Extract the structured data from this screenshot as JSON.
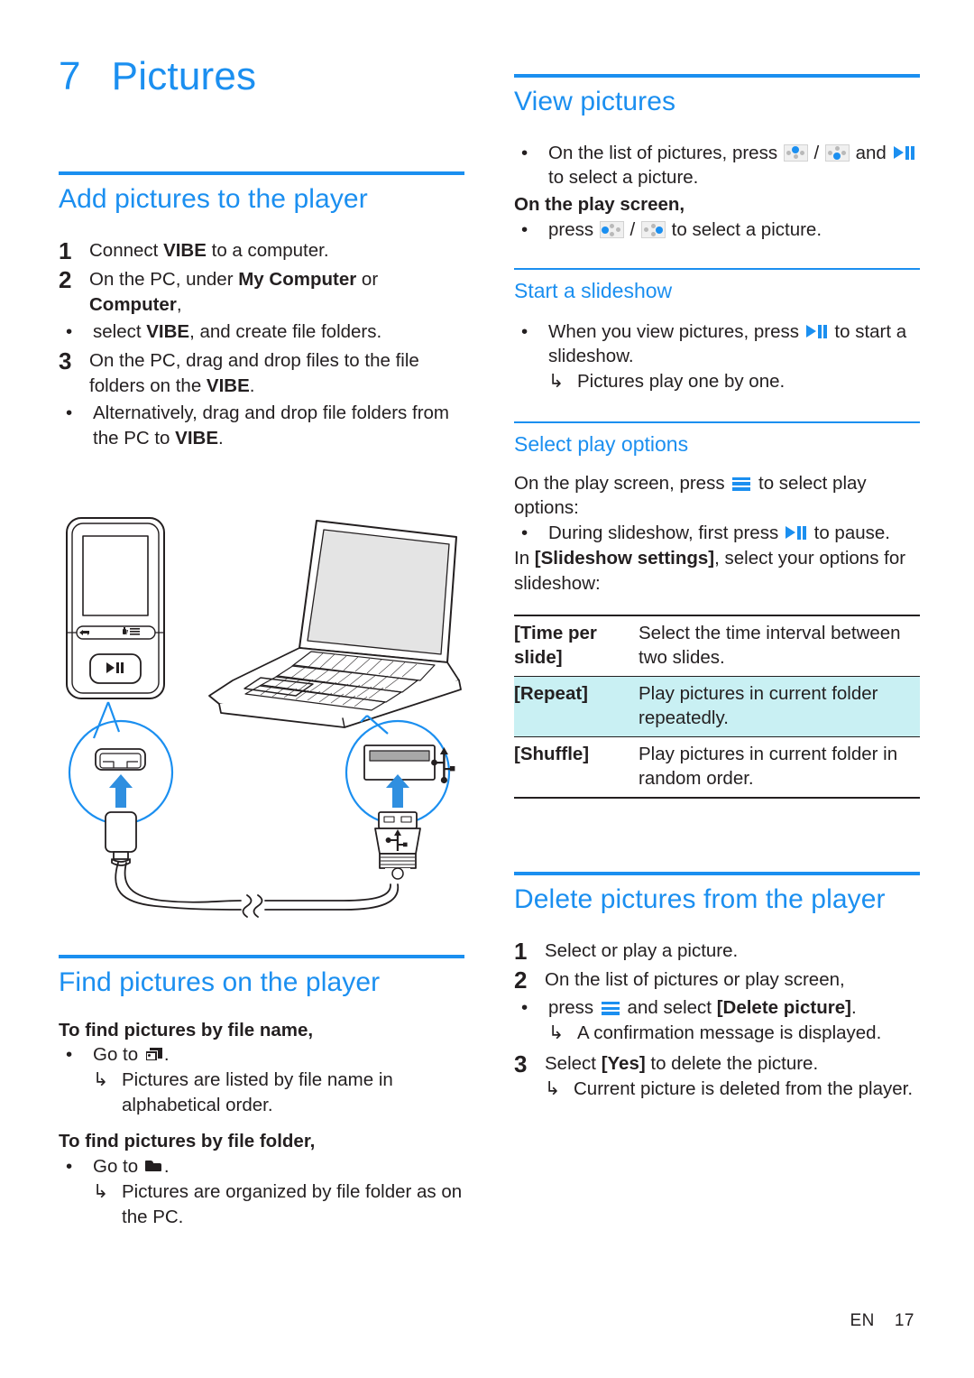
{
  "meta": {
    "accent_color": "#1b8ff0",
    "text_color": "#231f20",
    "highlight_row_color": "#c9f0f3"
  },
  "chapter": {
    "number": "7",
    "title": "Pictures"
  },
  "left_column": {
    "add_pictures": {
      "heading": "Add pictures to the player",
      "steps": [
        {
          "num": "1",
          "text_parts": [
            {
              "t": "Connect ",
              "b": false
            },
            {
              "t": "VIBE",
              "b": true
            },
            {
              "t": " to a computer.",
              "b": false
            }
          ],
          "plain": "Connect VIBE to a computer."
        },
        {
          "num": "2",
          "text_parts": [
            {
              "t": "On the PC, under ",
              "b": false
            },
            {
              "t": "My Computer",
              "b": true
            },
            {
              "t": " or ",
              "b": false
            },
            {
              "t": "Computer",
              "b": true
            },
            {
              "t": ",",
              "b": false
            }
          ],
          "plain": "On the PC, under My Computer or Computer,",
          "bullets": [
            {
              "text_parts": [
                {
                  "t": "select ",
                  "b": false
                },
                {
                  "t": "VIBE",
                  "b": true
                },
                {
                  "t": ", and create file folders.",
                  "b": false
                }
              ],
              "plain": "select VIBE, and create file folders."
            }
          ]
        },
        {
          "num": "3",
          "text_parts": [
            {
              "t": "On the PC, drag and drop files to the file folders on the ",
              "b": false
            },
            {
              "t": "VIBE",
              "b": true
            },
            {
              "t": ".",
              "b": false
            }
          ],
          "plain": "On the PC, drag and drop files to the file folders on the VIBE.",
          "bullets": [
            {
              "text_parts": [
                {
                  "t": "Alternatively, drag and drop file folders from the PC to ",
                  "b": false
                },
                {
                  "t": "VIBE",
                  "b": true
                },
                {
                  "t": ".",
                  "b": false
                }
              ],
              "plain": "Alternatively, drag and drop file folders from the PC to VIBE."
            }
          ]
        }
      ]
    },
    "illustration": {
      "name": "player-to-pc-usb-connection-diagram",
      "elements": [
        "mp3-player",
        "laptop",
        "usb-cable",
        "player-port-callout",
        "laptop-usb-port-callout",
        "usb-symbol"
      ]
    },
    "find_pictures": {
      "heading": "Find pictures on the player",
      "group_by_name": {
        "lead": "To find pictures by file name,",
        "bullet_prefix": "Go to",
        "bullet_icon": "pictures-icon",
        "bullet_suffix": ".",
        "result": "Pictures are listed by file name in alphabetical order."
      },
      "group_by_folder": {
        "lead": "To find pictures by file folder,",
        "bullet_prefix": "Go to",
        "bullet_icon": "folder-icon",
        "bullet_suffix": ".",
        "result": "Pictures are organized by file folder as on the PC."
      }
    }
  },
  "right_column": {
    "view_pictures": {
      "heading": "View pictures",
      "bullet1_pre": "On the list of pictures, press",
      "bullet1_mid": "/",
      "bullet1_post": "and",
      "bullet1_end": "to select a picture.",
      "lead_bold": "On the play screen,",
      "bullet2_pre": "press",
      "bullet2_mid": "/",
      "bullet2_post": "to select a picture."
    },
    "start_slideshow": {
      "heading": "Start a slideshow",
      "bullet_pre": "When you view pictures, press",
      "bullet_post": "to start a slideshow.",
      "result": "Pictures play one by one."
    },
    "select_play_options": {
      "heading": "Select play options",
      "lead_pre": "On the play screen, press",
      "lead_post": "to select play options:",
      "bullet_pre": "During slideshow, first press",
      "bullet_post": "to pause.",
      "in_text_pre": "In ",
      "in_text_bold": "[Slideshow settings]",
      "in_text_post": ", select your options for slideshow:",
      "table": {
        "rows": [
          {
            "key": "[Time per slide]",
            "value": "Select the time interval between two slides.",
            "highlight": false
          },
          {
            "key": "[Repeat]",
            "value": "Play pictures in current folder repeatedly.",
            "highlight": true
          },
          {
            "key": "[Shuffle]",
            "value": "Play pictures in current folder in random order.",
            "highlight": false
          }
        ]
      }
    },
    "delete_pictures": {
      "heading": "Delete pictures from the player",
      "steps": [
        {
          "num": "1",
          "plain": "Select or play a picture."
        },
        {
          "num": "2",
          "plain": "On the list of pictures or play screen,"
        }
      ],
      "step2_bullet_pre": "press",
      "step2_bullet_mid": "and select",
      "step2_bullet_bold": "[Delete picture]",
      "step2_bullet_end": ".",
      "step2_result": "A confirmation message is displayed.",
      "step3_num": "3",
      "step3_pre": "Select",
      "step3_bold": "[Yes]",
      "step3_post": "to delete the picture.",
      "step3_result": "Current picture is deleted from the player."
    }
  },
  "footer": {
    "language": "EN",
    "page_number": "17"
  }
}
